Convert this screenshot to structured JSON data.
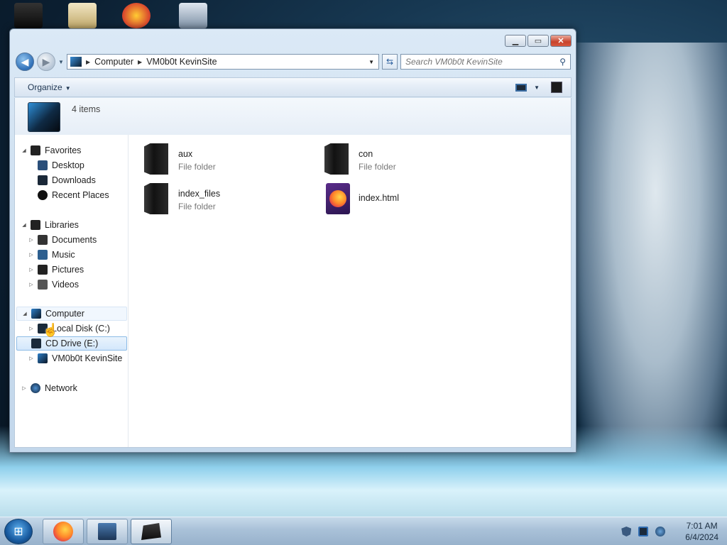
{
  "desktop": {
    "icons": [
      {
        "name": "recycle-bin-icon"
      },
      {
        "name": "mail-icon"
      },
      {
        "name": "app-p-icon"
      },
      {
        "name": "network-computer-icon"
      }
    ]
  },
  "window": {
    "address": {
      "segments": [
        "Computer",
        "VM0b0t KevinSite"
      ]
    },
    "search": {
      "placeholder": "Search VM0b0t KevinSite"
    },
    "toolbar": {
      "organize_label": "Organize"
    },
    "info": {
      "item_count": "4 items"
    },
    "nav_tree": {
      "favorites": {
        "label": "Favorites",
        "items": [
          "Desktop",
          "Downloads",
          "Recent Places"
        ]
      },
      "libraries": {
        "label": "Libraries",
        "items": [
          "Documents",
          "Music",
          "Pictures",
          "Videos"
        ]
      },
      "computer": {
        "label": "Computer",
        "items": [
          "Local Disk (C:)",
          "CD Drive (E:)",
          "VM0b0t KevinSite"
        ]
      },
      "network": {
        "label": "Network"
      }
    },
    "files": [
      {
        "name": "aux",
        "type": "File folder"
      },
      {
        "name": "con",
        "type": "File folder"
      },
      {
        "name": "index_files",
        "type": "File folder"
      },
      {
        "name": "index.html",
        "type": ""
      }
    ]
  },
  "taskbar": {
    "clock_time": "7:01 AM",
    "clock_date": "6/4/2024"
  },
  "colors": {
    "accent": "#2f6fb7",
    "selection": "#d3e7fb",
    "taskbar": "#a9c1d8"
  }
}
